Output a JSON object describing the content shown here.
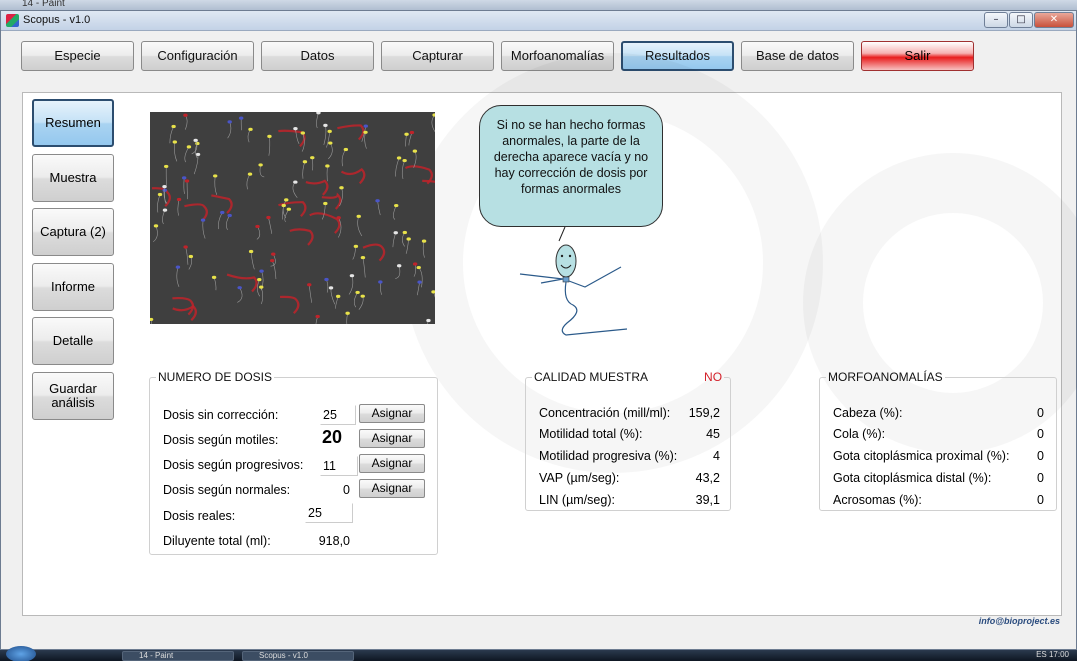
{
  "background_window": {
    "title": "14 - Paint"
  },
  "window": {
    "title": "Scopus - v1.0",
    "controls": [
      "–",
      "□",
      "✕"
    ]
  },
  "topnav": {
    "items": [
      {
        "label": "Especie"
      },
      {
        "label": "Configuración"
      },
      {
        "label": "Datos"
      },
      {
        "label": "Capturar"
      },
      {
        "label": "Morfoanomalías"
      },
      {
        "label": "Resultados",
        "active": true
      },
      {
        "label": "Base de datos"
      },
      {
        "label": "Salir"
      }
    ]
  },
  "sidenav": {
    "items": [
      {
        "label": "Resumen",
        "active": true
      },
      {
        "label": "Muestra"
      },
      {
        "label": "Captura (2)"
      },
      {
        "label": "Informe"
      },
      {
        "label": "Detalle"
      },
      {
        "label": "Guardar análisis"
      }
    ]
  },
  "sample_image": {
    "description": "microscope-sperm-sample"
  },
  "bubble": {
    "text": "Si no se han hecho formas anormales, la parte de la derecha aparece vacía y no hay corrección de dosis por formas anormales"
  },
  "dosis": {
    "title": "NUMERO DE DOSIS",
    "rows": [
      {
        "label": "Dosis sin corrección:",
        "value": "25"
      },
      {
        "label": "Dosis según motiles:",
        "value": "20"
      },
      {
        "label": "Dosis según progresivos:",
        "value": "11"
      },
      {
        "label": "Dosis según normales:",
        "value": "0"
      },
      {
        "label": "Dosis reales:",
        "value": "25"
      },
      {
        "label": "Diluyente total (ml):",
        "value": "918,0"
      }
    ],
    "assign_label": "Asignar"
  },
  "calidad": {
    "title": "CALIDAD MUESTRA",
    "status": "NO",
    "status_color": "#d4202a",
    "rows": [
      {
        "label": "Concentración (mill/ml):",
        "value": "159,2"
      },
      {
        "label": "Motilidad total (%):",
        "value": "45"
      },
      {
        "label": "Motilidad progresiva (%):",
        "value": "4"
      },
      {
        "label": "VAP (µm/seg):",
        "value": "43,2"
      },
      {
        "label": "LIN (µm/seg):",
        "value": "39,1"
      }
    ]
  },
  "morfo": {
    "title": "MORFOANOMALÍAS",
    "rows": [
      {
        "label": "Cabeza (%):",
        "value": "0"
      },
      {
        "label": "Cola (%):",
        "value": "0"
      },
      {
        "label": "Gota citoplásmica proximal (%):",
        "value": "0"
      },
      {
        "label": "Gota citoplásmica distal (%):",
        "value": "0"
      },
      {
        "label": "Acrosomas (%):",
        "value": "0"
      }
    ]
  },
  "footer": {
    "email": "info@bioproject.es"
  },
  "taskbar": {
    "items": [
      {
        "label": "14 - Paint"
      },
      {
        "label": "Scopus - v1.0"
      }
    ],
    "tray": "ES  17:00"
  }
}
